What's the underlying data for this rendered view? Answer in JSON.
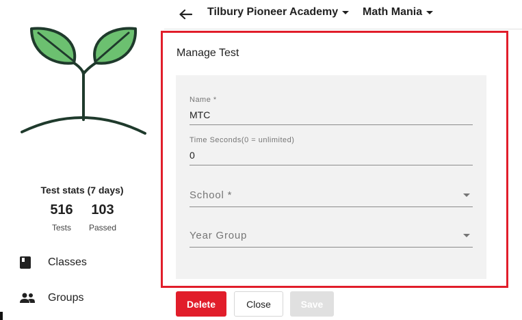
{
  "sidebar": {
    "stats_title": "Test stats (7 days)",
    "stats": [
      {
        "value": "516",
        "label": "Tests"
      },
      {
        "value": "103",
        "label": "Passed"
      }
    ],
    "nav": [
      {
        "label": "Classes",
        "icon": "book-icon"
      },
      {
        "label": "Groups",
        "icon": "people-icon"
      }
    ]
  },
  "topbar": {
    "school": "Tilbury Pioneer Academy",
    "app": "Math Mania"
  },
  "panel": {
    "title": "Manage Test",
    "fields": {
      "name_label": "Name *",
      "name_value": "MTC",
      "time_label": "Time Seconds(0 = unlimited)",
      "time_value": "0",
      "school_placeholder": "School *",
      "year_placeholder": "Year Group"
    }
  },
  "buttons": {
    "delete": "Delete",
    "close": "Close",
    "save": "Save"
  },
  "colors": {
    "accent_red": "#e11d2a",
    "logo_green": "#6cc070",
    "logo_stroke": "#1f3a2c"
  }
}
